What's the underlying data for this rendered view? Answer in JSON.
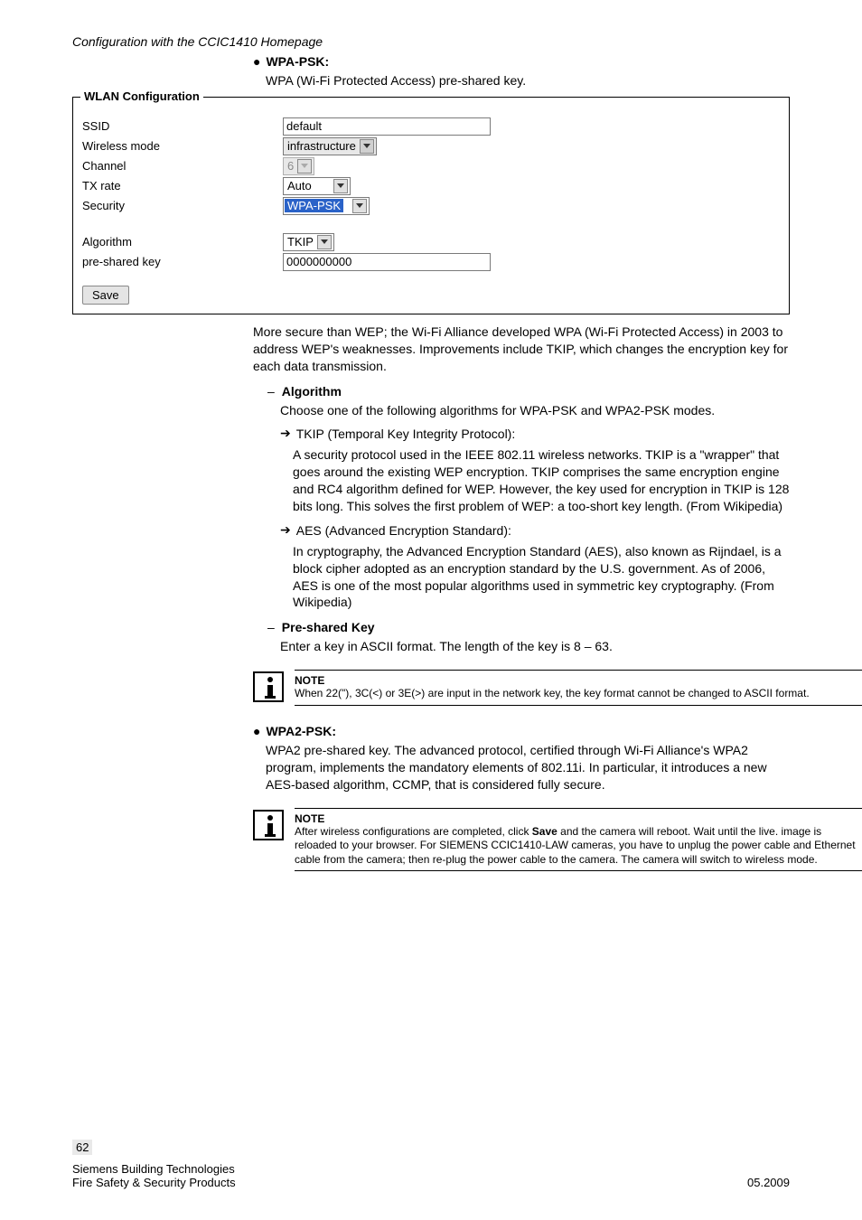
{
  "header": {
    "breadcrumb": "Configuration with the CCIC1410 Homepage"
  },
  "wpa_psk": {
    "title": "WPA-PSK:",
    "subtitle": "WPA (Wi-Fi Protected Access) pre-shared key."
  },
  "wlan": {
    "legend": "WLAN Configuration",
    "ssid_label": "SSID",
    "ssid_value": "default",
    "mode_label": "Wireless mode",
    "mode_value": "infrastructure",
    "channel_label": "Channel",
    "channel_value": "6",
    "tx_label": "TX rate",
    "tx_value": "Auto",
    "security_label": "Security",
    "security_value": "WPA-PSK",
    "algo_label": "Algorithm",
    "algo_value": "TKIP",
    "psk_label": "pre-shared key",
    "psk_value": "0000000000",
    "save": "Save"
  },
  "after_fig": "More secure than WEP; the Wi-Fi Alliance developed WPA (Wi-Fi Protected Access) in 2003 to address WEP's weaknesses. Improvements include TKIP, which changes the encryption key for each data transmission.",
  "algo_section": {
    "title": "Algorithm",
    "intro": "Choose one of the following algorithms for WPA-PSK and WPA2-PSK modes.",
    "tkip_title": "TKIP (Temporal Key Integrity Protocol):",
    "tkip_body": "A security protocol used in the IEEE 802.11 wireless networks. TKIP is a \"wrapper\" that goes around the existing WEP encryption. TKIP comprises the same encryption engine and RC4 algorithm defined for WEP. However, the key used for encryption in TKIP is 128 bits long. This solves the first problem of WEP: a too-short key length. (From Wikipedia)",
    "aes_title": "AES (Advanced Encryption Standard):",
    "aes_body": "In cryptography, the Advanced Encryption Standard (AES), also known as Rijndael, is a block cipher adopted as an encryption standard by the U.S. government. As of 2006, AES is one of the most popular algorithms used in symmetric key cryptography. (From Wikipedia)"
  },
  "psk_section": {
    "title": "Pre-shared Key",
    "body": "Enter a key in ASCII format. The length of the key is 8 – 63."
  },
  "note1": {
    "label": "NOTE",
    "body": "When 22(\"), 3C(<) or 3E(>) are input in the network key, the key format cannot be changed to ASCII format."
  },
  "wpa2": {
    "title": "WPA2-PSK:",
    "body": "WPA2 pre-shared key. The advanced protocol, certified through Wi-Fi Alliance's WPA2 program, implements the mandatory elements of 802.11i. In particular, it introduces a new AES-based algorithm, CCMP, that is considered fully secure."
  },
  "note2": {
    "label": "NOTE",
    "body_1": "After wireless configurations are completed, click ",
    "body_bold": "Save",
    "body_2": " and the camera will reboot. Wait until the live. image is reloaded to your browser. For SIEMENS CCIC1410-LAW cameras, you have to unplug the power cable and Ethernet cable from the camera; then re-plug the power cable to the camera. The camera will switch to wireless mode."
  },
  "footer": {
    "page": "62",
    "left1": "Siemens Building Technologies",
    "left2": "Fire Safety & Security Products",
    "right": "05.2009"
  }
}
